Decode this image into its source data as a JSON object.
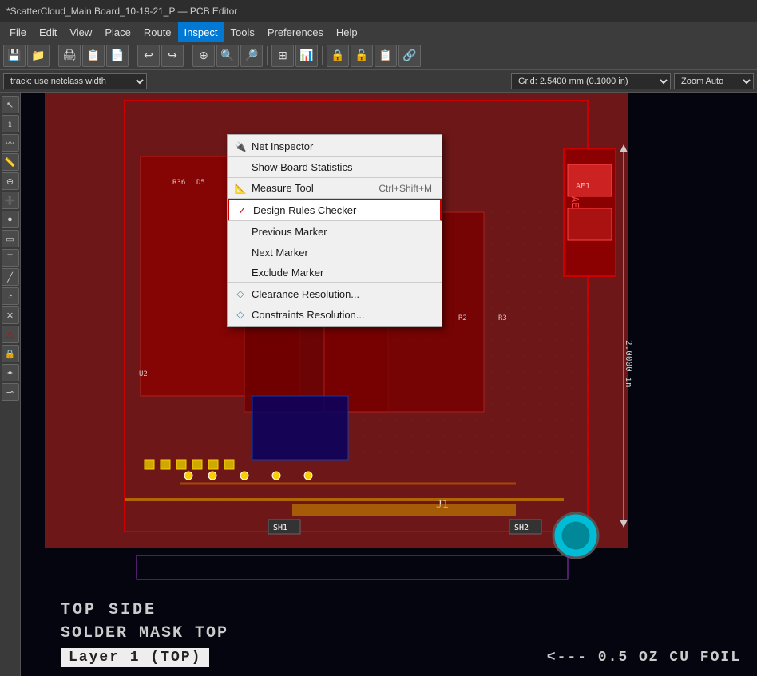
{
  "titleBar": {
    "text": "*ScatterCloud_Main Board_10-19-21_P — PCB Editor"
  },
  "menuBar": {
    "items": [
      "File",
      "Edit",
      "View",
      "Place",
      "Route",
      "Inspect",
      "Tools",
      "Preferences",
      "Help"
    ]
  },
  "inspectMenu": {
    "title": "Inspect",
    "items": [
      {
        "id": "net-inspector",
        "label": "Net Inspector",
        "icon": "🔌",
        "shortcut": "",
        "hasIcon": true,
        "iconColor": "#cc0000"
      },
      {
        "id": "show-board-stats",
        "label": "Show Board Statistics",
        "icon": "",
        "shortcut": "",
        "hasSeparator": true
      },
      {
        "id": "measure-tool",
        "label": "Measure Tool",
        "icon": "📏",
        "shortcut": "Ctrl+Shift+M"
      },
      {
        "id": "design-rules",
        "label": "Design Rules Checker",
        "icon": "✓",
        "shortcut": "",
        "highlighted": true,
        "hasSeparator": true
      },
      {
        "id": "prev-marker",
        "label": "Previous Marker",
        "icon": "",
        "shortcut": ""
      },
      {
        "id": "next-marker",
        "label": "Next Marker",
        "icon": "",
        "shortcut": ""
      },
      {
        "id": "exclude-marker",
        "label": "Exclude Marker",
        "icon": "",
        "shortcut": "",
        "hasSeparator": true
      },
      {
        "id": "clearance-res",
        "label": "Clearance Resolution...",
        "icon": "◇",
        "shortcut": ""
      },
      {
        "id": "constraints-res",
        "label": "Constraints Resolution...",
        "icon": "◇",
        "shortcut": ""
      }
    ]
  },
  "secondaryToolbar": {
    "trackLabel": "track: use netclass width",
    "gridLabel": "Grid: 2.5400 mm (0.1000 in)",
    "zoomLabel": "Zoom Auto"
  },
  "bottomBar": {
    "line1": "TOP SIDE",
    "line2": "SOLDER MASK TOP",
    "line3": "Layer 1 (TOP)",
    "line4": "<--- 0.5 OZ CU FOIL"
  },
  "pcbLabels": {
    "ae1": "AE1",
    "sh1": "SH1",
    "sh2": "SH2",
    "j1": "J1",
    "dimension": "2.0000 in"
  },
  "icons": {
    "net-inspector": "🔌",
    "measure": "📐",
    "drc": "✓",
    "clearance": "◇",
    "constraints": "◇"
  }
}
